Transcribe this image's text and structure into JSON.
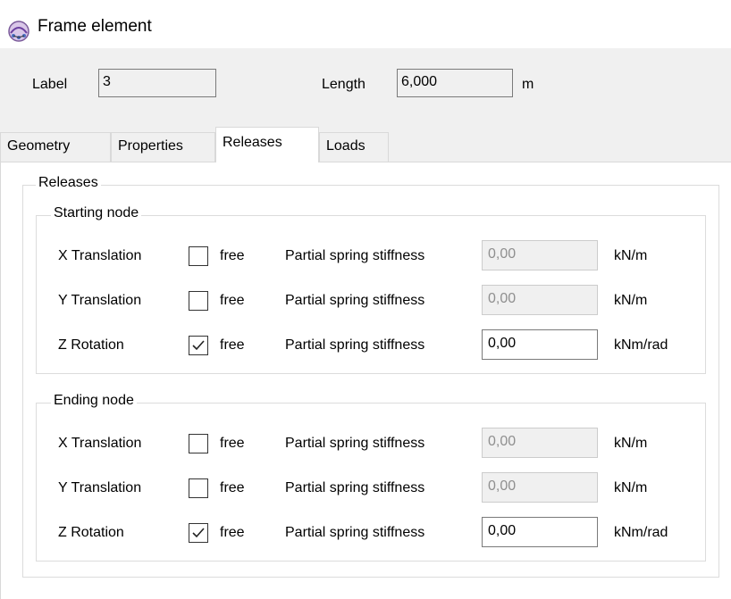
{
  "window": {
    "title": "Frame element",
    "icon": "frame-element-icon"
  },
  "header": {
    "label_caption": "Label",
    "label_value": "3",
    "length_caption": "Length",
    "length_value": "6,000",
    "length_unit": "m"
  },
  "tabs": [
    {
      "label": "Geometry",
      "active": false
    },
    {
      "label": "Properties",
      "active": false
    },
    {
      "label": "Releases",
      "active": true
    },
    {
      "label": "Loads",
      "active": false
    }
  ],
  "releases": {
    "title": "Releases",
    "starting_node": {
      "title": "Starting node",
      "rows": [
        {
          "label": "X Translation",
          "free_label": "free",
          "free_checked": false,
          "stiffness_label": "Partial spring stiffness",
          "stiffness_value": "0,00",
          "enabled": false,
          "unit": "kN/m"
        },
        {
          "label": "Y Translation",
          "free_label": "free",
          "free_checked": false,
          "stiffness_label": "Partial spring stiffness",
          "stiffness_value": "0,00",
          "enabled": false,
          "unit": "kN/m"
        },
        {
          "label": "Z Rotation",
          "free_label": "free",
          "free_checked": true,
          "stiffness_label": "Partial spring stiffness",
          "stiffness_value": "0,00",
          "enabled": true,
          "unit": "kNm/rad"
        }
      ]
    },
    "ending_node": {
      "title": "Ending node",
      "rows": [
        {
          "label": "X Translation",
          "free_label": "free",
          "free_checked": false,
          "stiffness_label": "Partial spring stiffness",
          "stiffness_value": "0,00",
          "enabled": false,
          "unit": "kN/m"
        },
        {
          "label": "Y Translation",
          "free_label": "free",
          "free_checked": false,
          "stiffness_label": "Partial spring stiffness",
          "stiffness_value": "0,00",
          "enabled": false,
          "unit": "kN/m"
        },
        {
          "label": "Z Rotation",
          "free_label": "free",
          "free_checked": true,
          "stiffness_label": "Partial spring stiffness",
          "stiffness_value": "0,00",
          "enabled": true,
          "unit": "kNm/rad"
        }
      ]
    }
  }
}
